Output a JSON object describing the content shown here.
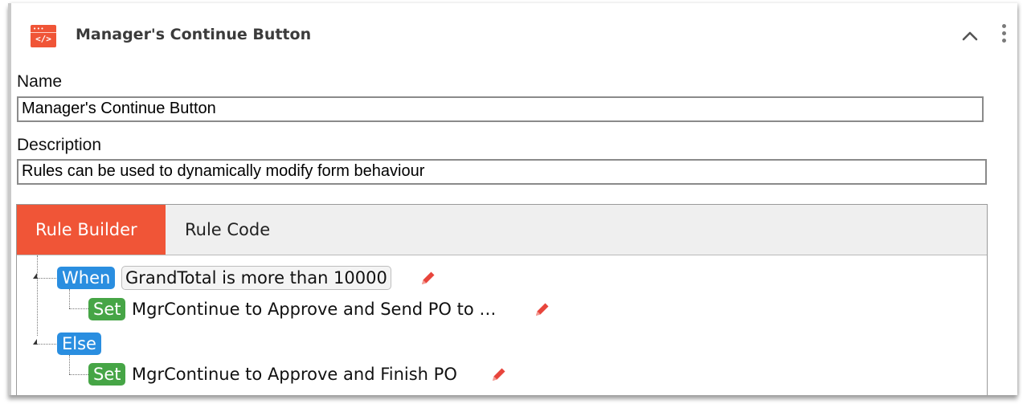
{
  "header": {
    "icon": "code-window-icon",
    "icon_dots": "•••",
    "icon_code": "</>",
    "title": "Manager's Continue Button",
    "collapse_icon": "chevron-up-icon",
    "menu_icon": "vertical-ellipsis-icon"
  },
  "form": {
    "name_label": "Name",
    "name_value": "Manager's Continue Button",
    "description_label": "Description",
    "description_value": "Rules can be used to dynamically modify form behaviour"
  },
  "rules": {
    "tabs": [
      {
        "label": "Rule Builder",
        "active": true
      },
      {
        "label": "Rule Code",
        "active": false
      }
    ],
    "tree": {
      "when_label": "When",
      "when_condition": "GrandTotal is more than 10000",
      "when_action_label": "Set",
      "when_action_text": "MgrContinue to Approve and Send PO to …",
      "else_label": "Else",
      "else_action_label": "Set",
      "else_action_text": "MgrContinue to Approve and Finish PO"
    }
  },
  "colors": {
    "accent": "#f05537",
    "when_badge": "#2a8ee0",
    "set_badge": "#46a546",
    "edit_icon": "#e8453c"
  }
}
